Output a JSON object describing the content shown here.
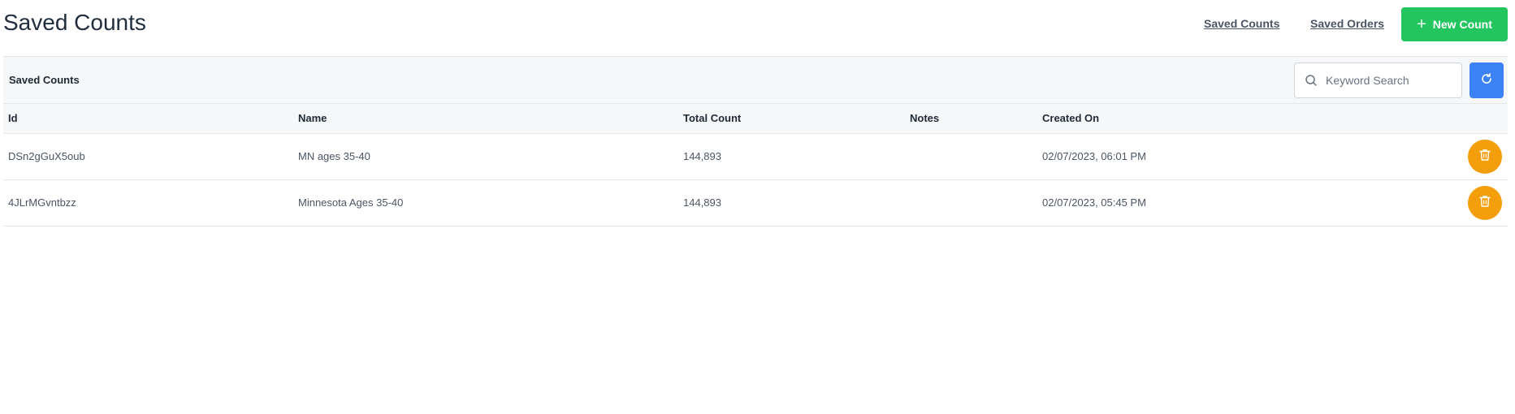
{
  "header": {
    "title": "Saved Counts",
    "nav": {
      "saved_counts": "Saved Counts",
      "saved_orders": "Saved Orders"
    },
    "new_count_button": "New Count",
    "new_count_icon": "plus-icon"
  },
  "card": {
    "title": "Saved Counts",
    "search": {
      "placeholder": "Keyword Search",
      "value": ""
    },
    "refresh_icon": "refresh-icon"
  },
  "table": {
    "columns": [
      "Id",
      "Name",
      "Total Count",
      "Notes",
      "Created On",
      ""
    ],
    "rows": [
      {
        "id": "DSn2gGuX5oub",
        "name": "MN ages 35-40",
        "total_count": "144,893",
        "notes": "",
        "created_on": "02/07/2023, 06:01 PM"
      },
      {
        "id": "4JLrMGvntbzz",
        "name": "Minnesota Ages 35-40",
        "total_count": "144,893",
        "notes": "",
        "created_on": "02/07/2023, 05:45 PM"
      }
    ]
  },
  "colors": {
    "primary_green": "#22c55e",
    "primary_blue": "#3b82f6",
    "delete_orange": "#f59e0b"
  }
}
